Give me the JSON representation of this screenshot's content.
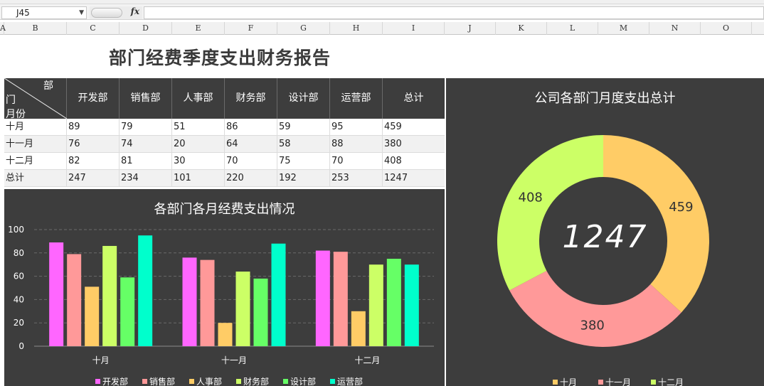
{
  "formula_bar": {
    "cell_ref": "J45",
    "fx_label": "fx"
  },
  "columns": [
    "A",
    "B",
    "C",
    "D",
    "E",
    "F",
    "G",
    "H",
    "I",
    "J",
    "K",
    "L",
    "M",
    "N",
    "O"
  ],
  "report_title": "部门经费季度支出财务报告",
  "table": {
    "corner_top": "部",
    "corner_mid": "门",
    "corner_bottom": "月份",
    "headers": [
      "开发部",
      "销售部",
      "人事部",
      "财务部",
      "设计部",
      "运营部",
      "总计"
    ],
    "rows": [
      {
        "label": "十月",
        "values": [
          "89",
          "79",
          "51",
          "86",
          "59",
          "95",
          "459"
        ]
      },
      {
        "label": "十一月",
        "values": [
          "76",
          "74",
          "20",
          "64",
          "58",
          "88",
          "380"
        ]
      },
      {
        "label": "十二月",
        "values": [
          "82",
          "81",
          "30",
          "70",
          "75",
          "70",
          "408"
        ]
      },
      {
        "label": "总计",
        "values": [
          "247",
          "234",
          "101",
          "220",
          "192",
          "253",
          "1247"
        ]
      }
    ]
  },
  "chart_data": [
    {
      "type": "bar",
      "title": "各部门各月经费支出情况",
      "categories": [
        "十月",
        "十一月",
        "十二月"
      ],
      "series": [
        {
          "name": "开发部",
          "color": "#ff66ff",
          "values": [
            89,
            76,
            82
          ]
        },
        {
          "name": "销售部",
          "color": "#ff9999",
          "values": [
            79,
            74,
            81
          ]
        },
        {
          "name": "人事部",
          "color": "#ffcc66",
          "values": [
            51,
            20,
            30
          ]
        },
        {
          "name": "财务部",
          "color": "#ccff66",
          "values": [
            86,
            64,
            70
          ]
        },
        {
          "name": "设计部",
          "color": "#66ff66",
          "values": [
            59,
            58,
            75
          ]
        },
        {
          "name": "运营部",
          "color": "#00ffcc",
          "values": [
            95,
            88,
            70
          ]
        }
      ],
      "ylim": [
        0,
        100
      ],
      "yticks": [
        0,
        20,
        40,
        60,
        80,
        100
      ],
      "grid": true,
      "legend": "bottom"
    },
    {
      "type": "pie",
      "title": "公司各部门月度支出总计",
      "donut": true,
      "center_label": "1247",
      "categories": [
        "十月",
        "十一月",
        "十二月"
      ],
      "values": [
        459,
        380,
        408
      ],
      "colors": [
        "#ffcc66",
        "#ff9999",
        "#ccff66"
      ],
      "legend": "bottom"
    }
  ]
}
